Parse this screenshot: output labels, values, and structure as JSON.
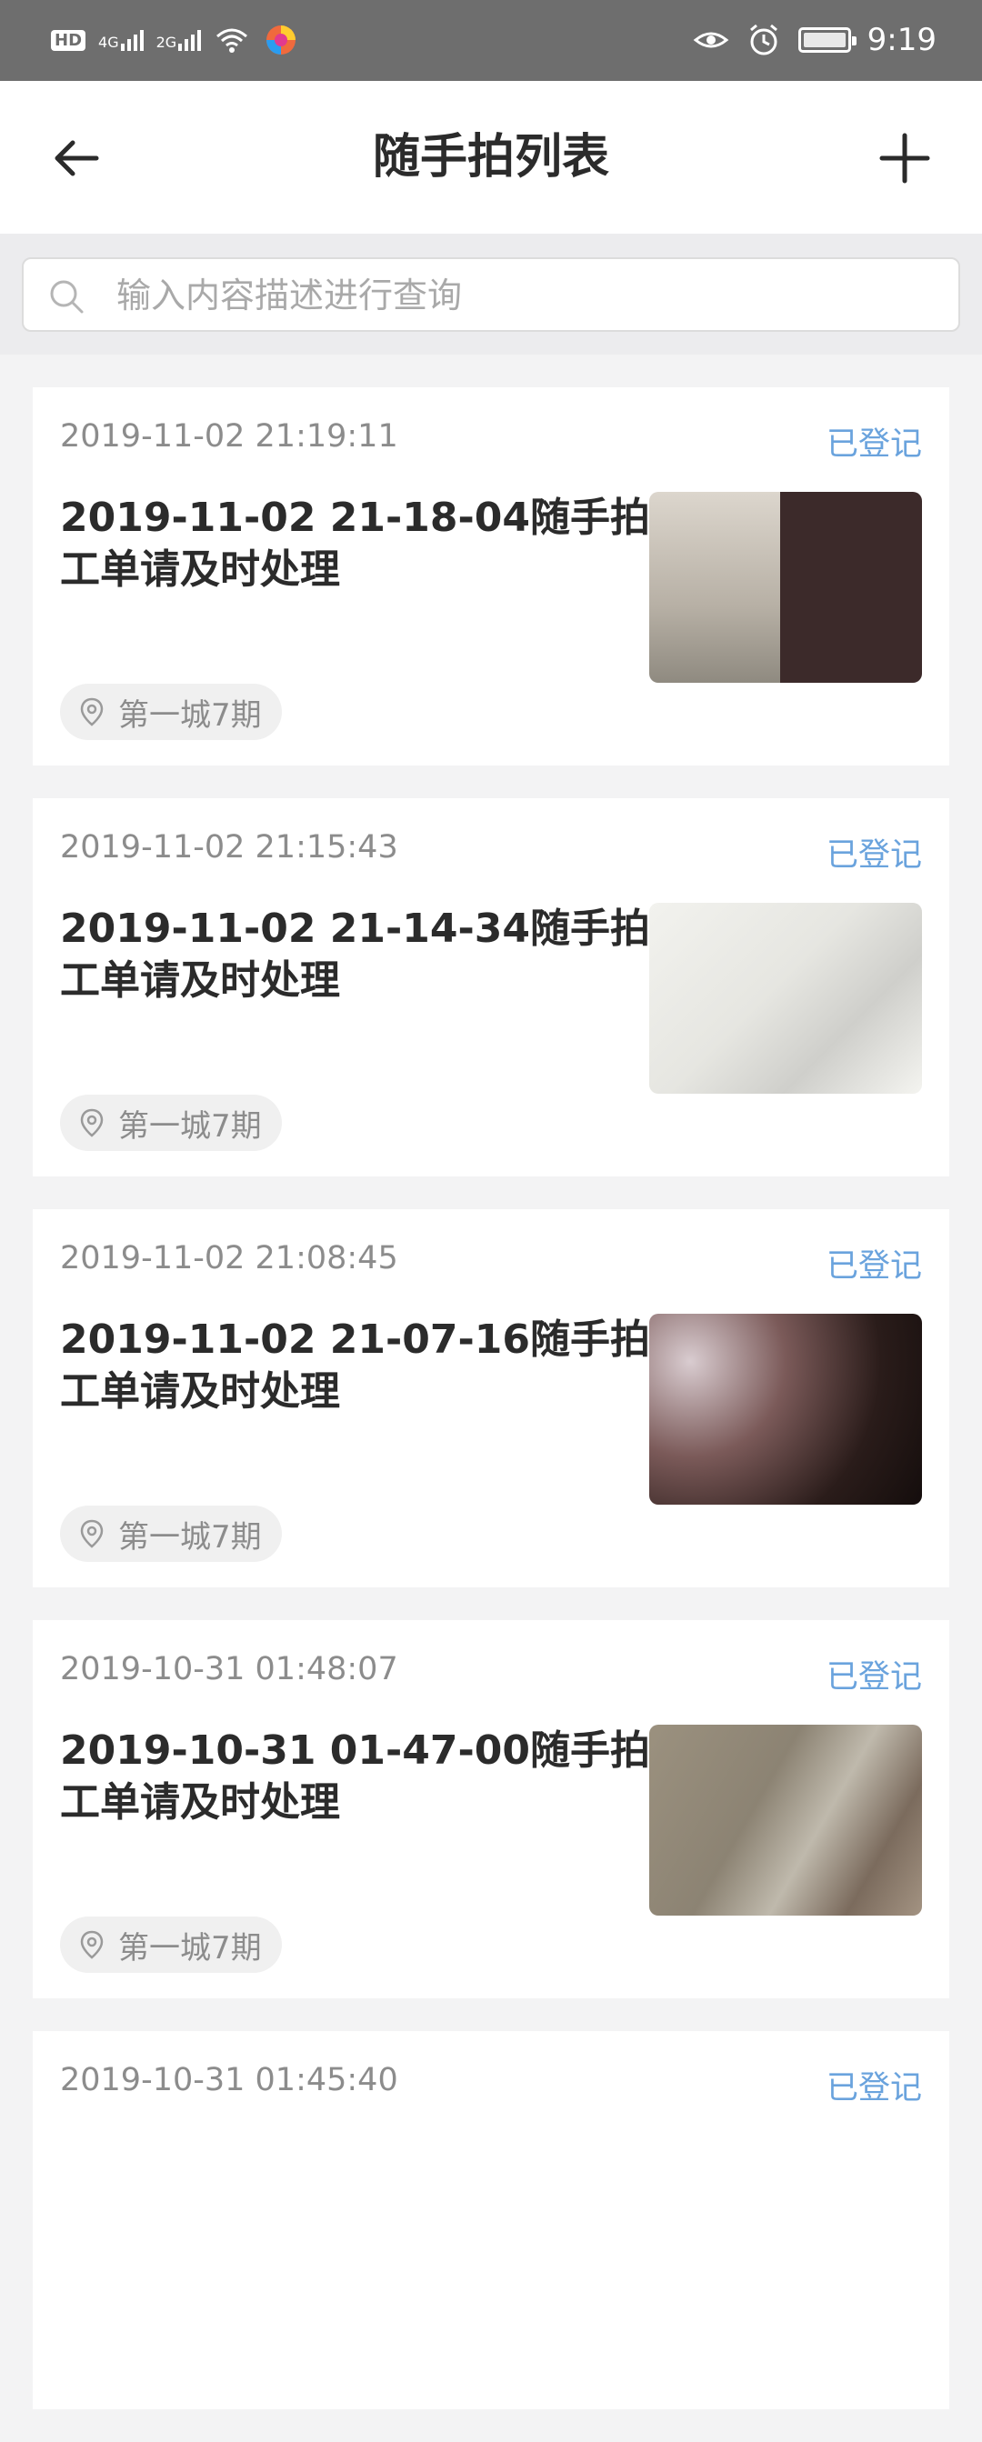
{
  "status_bar": {
    "left": {
      "hd": "HD",
      "net1": "4G",
      "net2": "2G"
    },
    "time": "9:19",
    "icons": [
      "eye-icon",
      "alarm-icon",
      "battery-icon"
    ]
  },
  "header": {
    "title": "随手拍列表",
    "back_icon": "arrow-left-icon",
    "add_icon": "plus-icon"
  },
  "search": {
    "placeholder": "输入内容描述进行查询",
    "value": "",
    "icon": "search-icon"
  },
  "items": [
    {
      "time": "2019-11-02 21:19:11",
      "status": "已登记",
      "title": "2019-11-02 21-18-04随手拍\n工单请及时处理",
      "location": "第一城7期"
    },
    {
      "time": "2019-11-02 21:15:43",
      "status": "已登记",
      "title": "2019-11-02 21-14-34随手拍\n工单请及时处理",
      "location": "第一城7期"
    },
    {
      "time": "2019-11-02 21:08:45",
      "status": "已登记",
      "title": "2019-11-02 21-07-16随手拍\n工单请及时处理",
      "location": "第一城7期"
    },
    {
      "time": "2019-10-31 01:48:07",
      "status": "已登记",
      "title": "2019-10-31 01-47-00随手拍\n工单请及时处理",
      "location": "第一城7期"
    },
    {
      "time": "2019-10-31 01:45:40",
      "status": "已登记",
      "title": "",
      "location": ""
    }
  ],
  "colors": {
    "status": "#6aa3dd",
    "background": "#f3f3f4",
    "statusbar": "#6e6e6e"
  }
}
